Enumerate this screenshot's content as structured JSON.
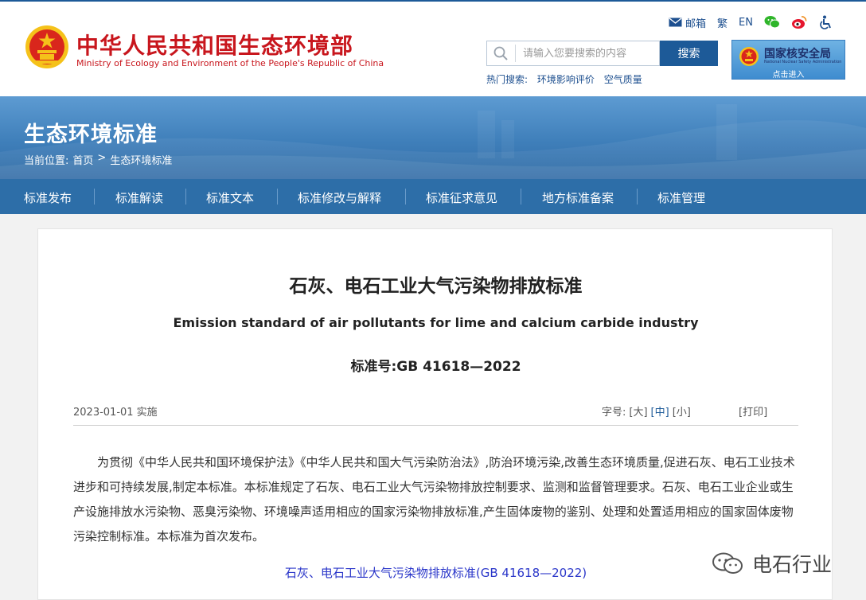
{
  "header": {
    "site_title_cn": "中华人民共和国生态环境部",
    "site_title_en": "Ministry of Ecology and Environment of the People's Republic of China",
    "top_links": {
      "mail": "邮箱",
      "traditional": "繁",
      "english": "EN"
    },
    "search": {
      "placeholder": "请输入您要搜索的内容",
      "button": "搜索"
    },
    "hot_search": {
      "label": "热门搜索:",
      "items": [
        "环境影响评价",
        "空气质量"
      ]
    },
    "nsa_banner": {
      "title": "国家核安全局",
      "subtitle": "National Nuclear Safety Administration",
      "enter": "点击进入"
    }
  },
  "banner": {
    "title": "生态环境标准",
    "breadcrumb": [
      "当前位置:",
      "首页",
      ">",
      "生态环境标准"
    ]
  },
  "nav": {
    "items": [
      "标准发布",
      "标准解读",
      "标准文本",
      "标准修改与解释",
      "标准征求意见",
      "地方标准备案",
      "标准管理"
    ]
  },
  "document": {
    "title": "石灰、电石工业大气污染物排放标准",
    "title_en": "Emission standard of air pollutants for lime and calcium carbide industry",
    "number": "标准号:GB 41618—2022",
    "date": "2023-01-01 实施",
    "font_size": {
      "label": "字号:",
      "large": "[大]",
      "medium": "[中]",
      "small": "[小]"
    },
    "print": "[打印]",
    "body": "为贯彻《中华人民共和国环境保护法》《中华人民共和国大气污染防治法》,防治环境污染,改善生态环境质量,促进石灰、电石工业技术进步和可持续发展,制定本标准。本标准规定了石灰、电石工业大气污染物排放控制要求、监测和监督管理要求。石灰、电石工业企业或生产设施排放水污染物、恶臭污染物、环境噪声适用相应的国家污染物排放标准,产生固体废物的鉴别、处理和处置适用相应的国家固体废物污染控制标准。本标准为首次发布。",
    "link": "石灰、电石工业大气污染物排放标准(GB 41618—2022)"
  },
  "watermark": {
    "text": "电石行业"
  },
  "colors": {
    "brand_red": "#c8161d",
    "brand_blue": "#1d5a98",
    "nav_bg": "#2d6ea8",
    "link_blue": "#2a36c9"
  }
}
